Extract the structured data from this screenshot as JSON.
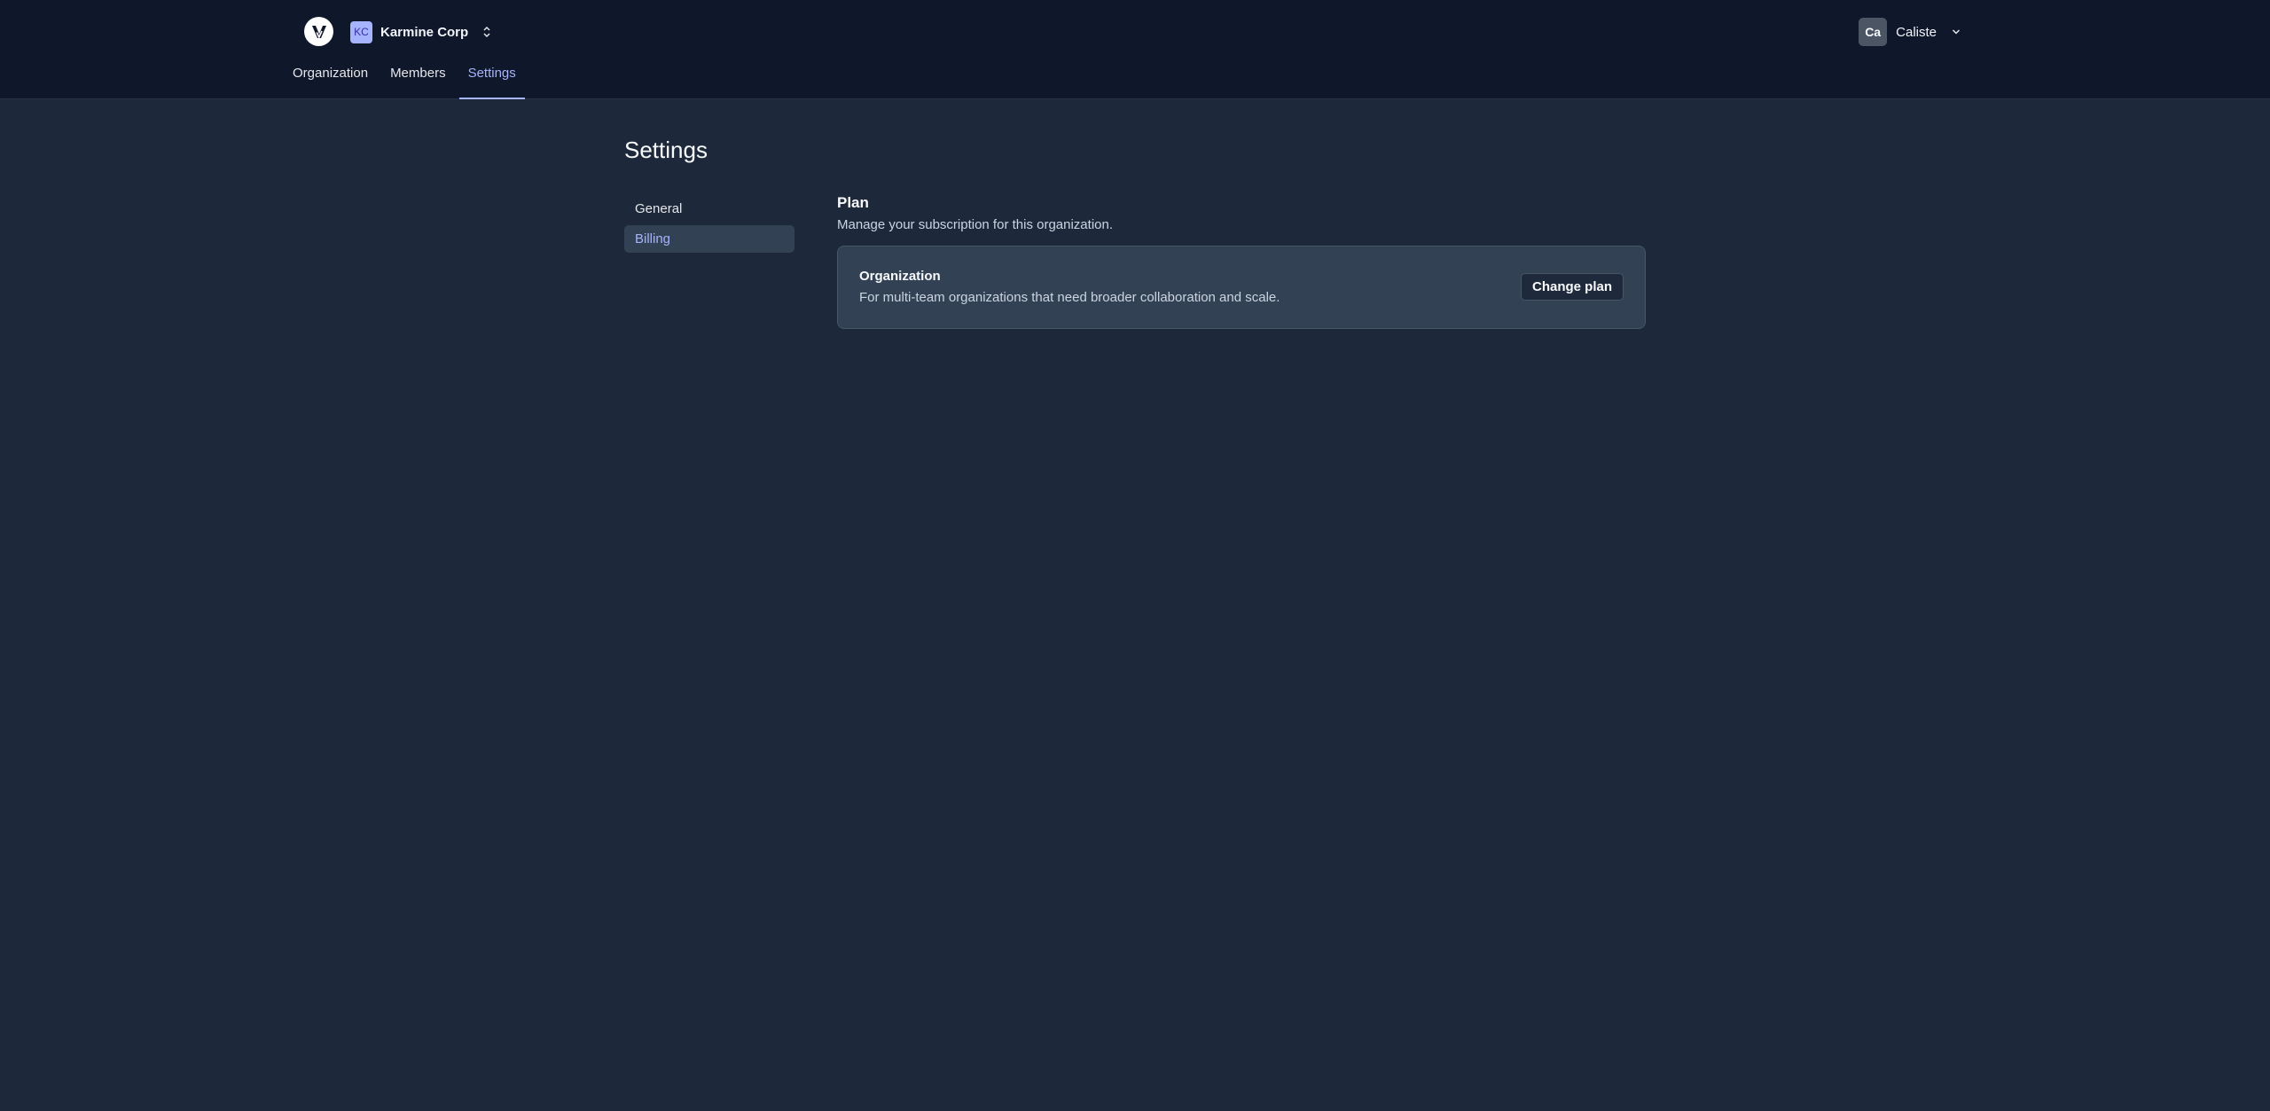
{
  "header": {
    "org": {
      "initials": "KC",
      "name": "Karmine Corp"
    },
    "user": {
      "initials": "Ca",
      "name": "Caliste"
    },
    "tabs": [
      {
        "label": "Organization",
        "active": false
      },
      {
        "label": "Members",
        "active": false
      },
      {
        "label": "Settings",
        "active": true
      }
    ]
  },
  "page": {
    "title": "Settings",
    "side_nav": [
      {
        "label": "General",
        "active": false
      },
      {
        "label": "Billing",
        "active": true
      }
    ],
    "plan_section": {
      "title": "Plan",
      "description": "Manage your subscription for this organization.",
      "card": {
        "name": "Organization",
        "description": "For multi-team organizations that need broader collaboration and scale.",
        "button_label": "Change plan"
      }
    }
  },
  "colors": {
    "accent": "#a5b4fc",
    "topbar_bg": "#0f172a",
    "page_bg": "#1d293b",
    "card_bg": "#334155"
  },
  "icons": {
    "logo": "v-check-logo-icon",
    "org_switch": "chevron-up-down-icon",
    "user_menu": "chevron-down-icon"
  }
}
